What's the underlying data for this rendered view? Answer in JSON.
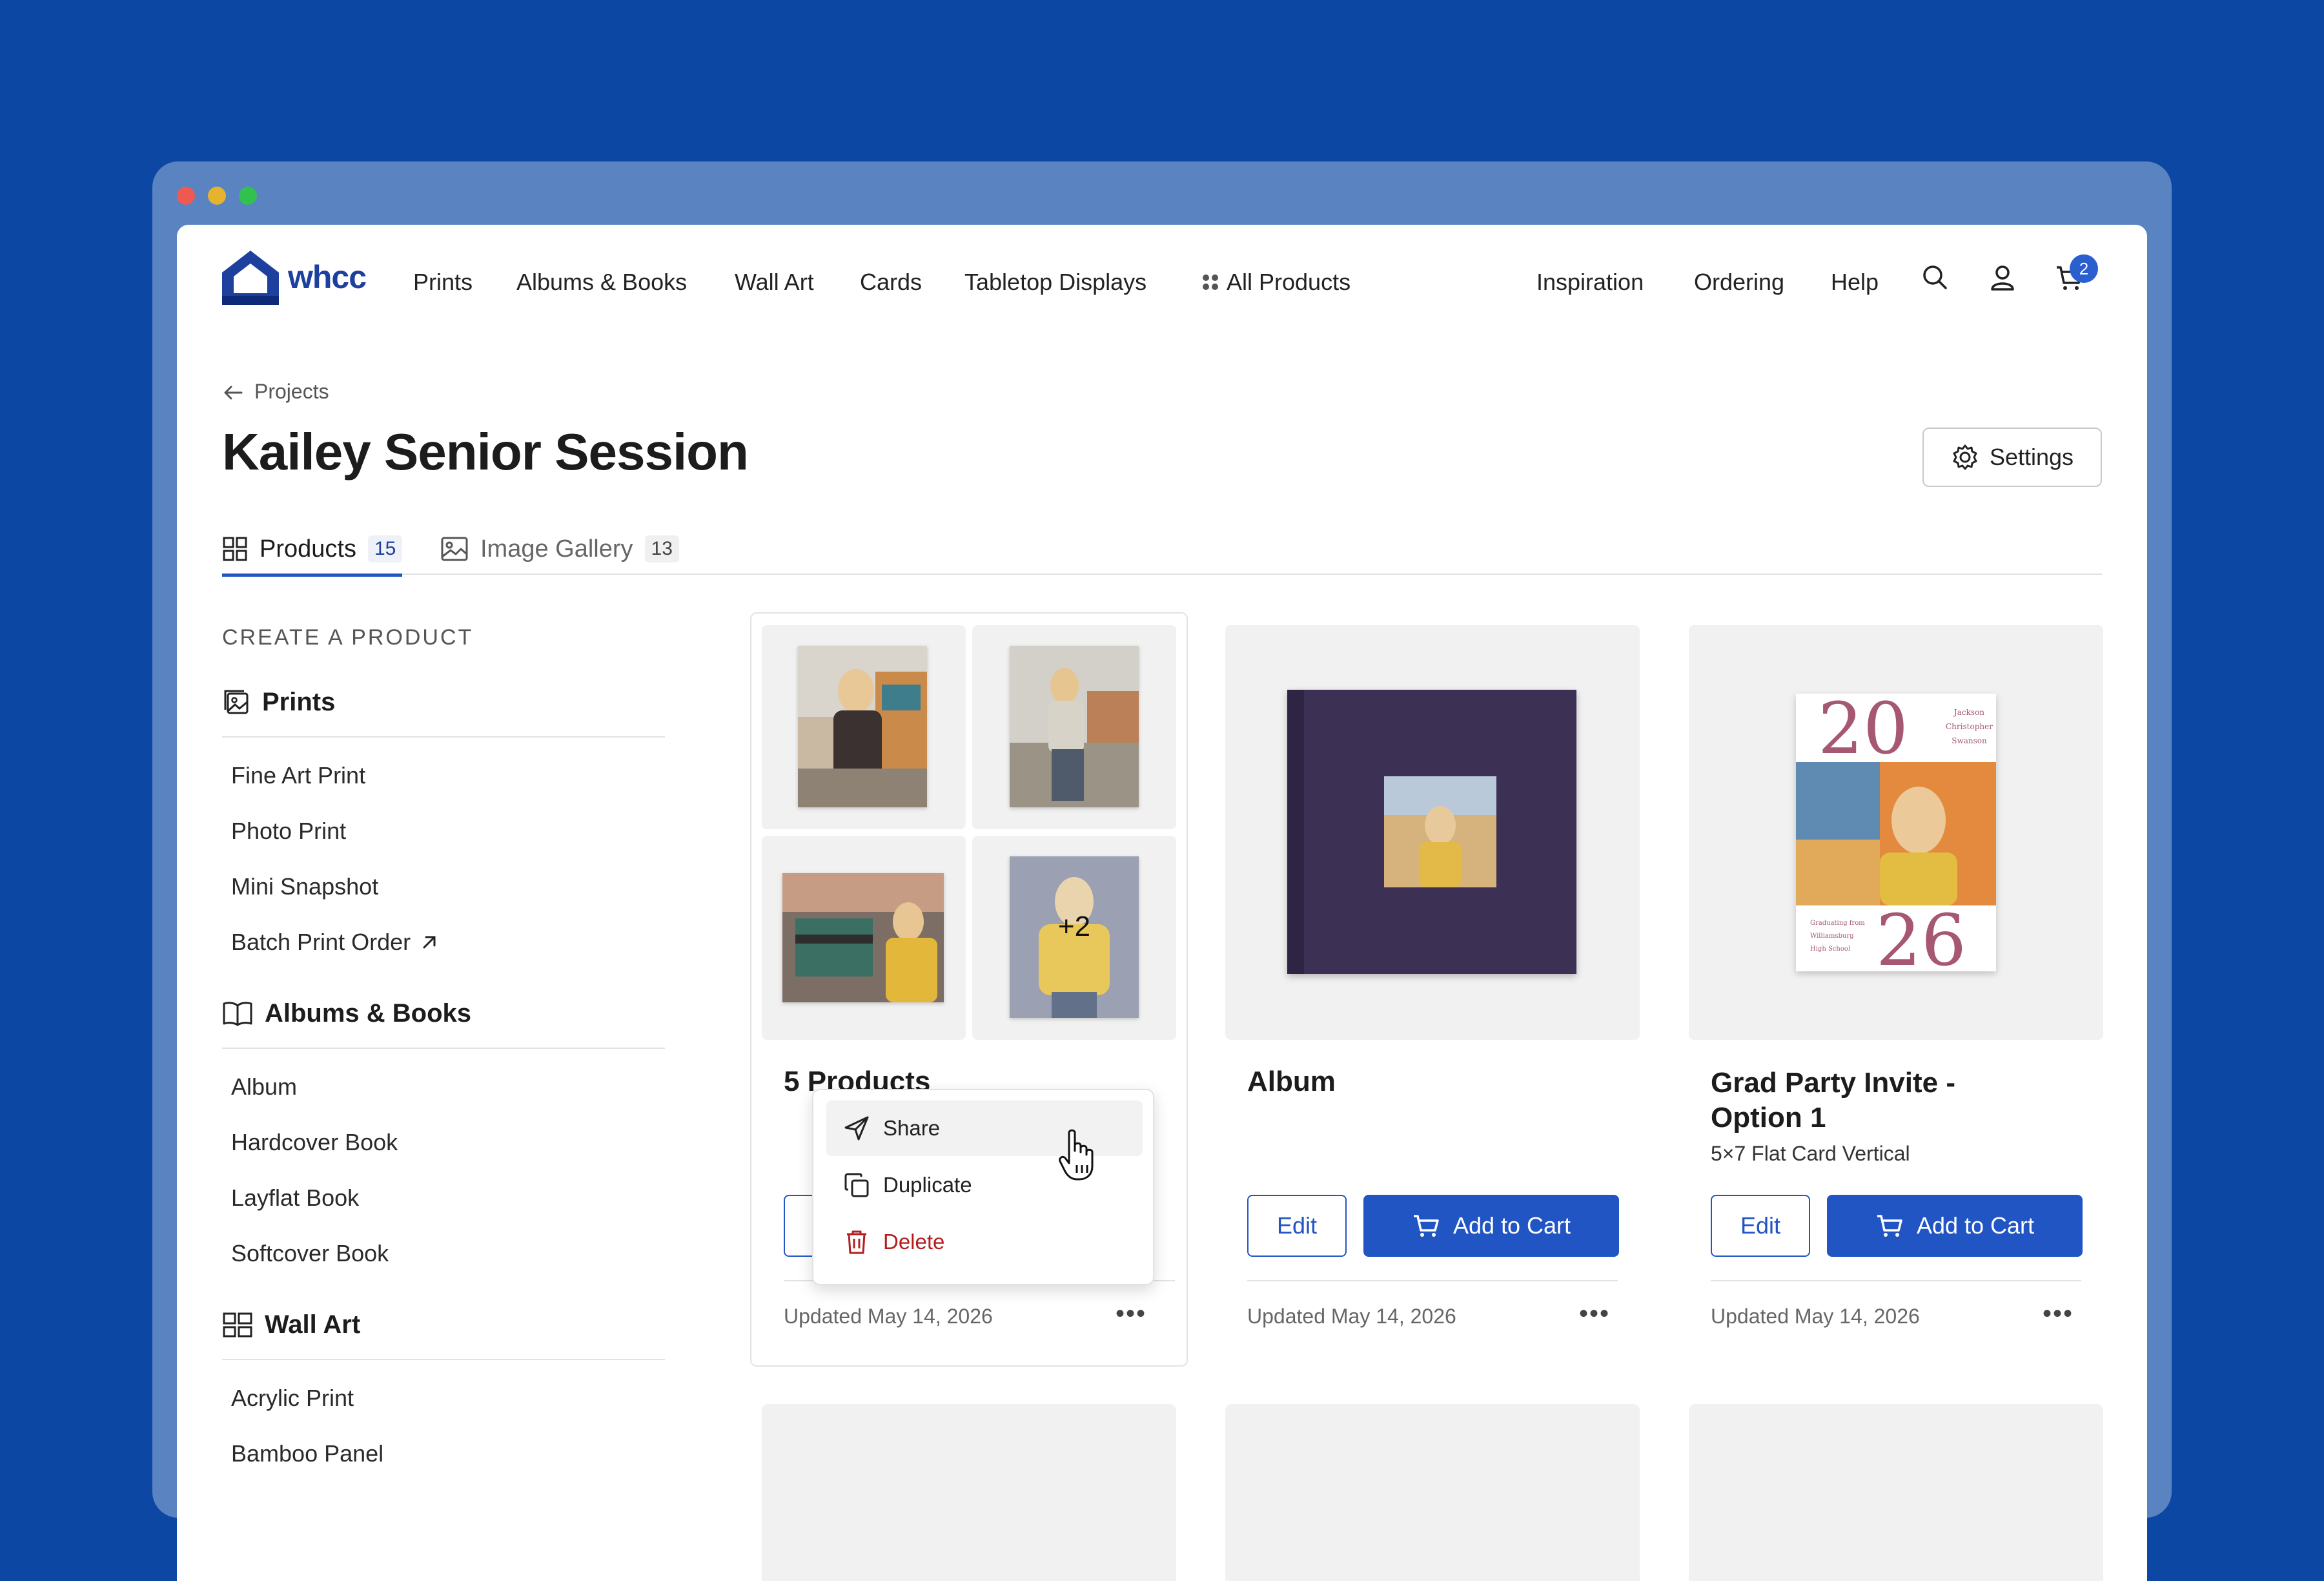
{
  "header": {
    "logo_text": "whcc",
    "nav": [
      "Prints",
      "Albums & Books",
      "Wall Art",
      "Cards",
      "Tabletop Displays",
      "All Products"
    ],
    "right_nav": [
      "Inspiration",
      "Ordering",
      "Help"
    ],
    "cart_count": "2"
  },
  "breadcrumb": "Projects",
  "page_title": "Kailey Senior Session",
  "settings_label": "Settings",
  "tabs": [
    {
      "label": "Products",
      "count": "15"
    },
    {
      "label": "Image Gallery",
      "count": "13"
    }
  ],
  "sidebar": {
    "heading": "CREATE A PRODUCT",
    "categories": [
      {
        "name": "Prints",
        "items": [
          "Fine Art Print",
          "Photo Print",
          "Mini Snapshot",
          "Batch Print Order"
        ]
      },
      {
        "name": "Albums & Books",
        "items": [
          "Album",
          "Hardcover Book",
          "Layflat Book",
          "Softcover Book"
        ]
      },
      {
        "name": "Wall Art",
        "items": [
          "Acrylic Print",
          "Bamboo Panel"
        ]
      }
    ]
  },
  "cards": [
    {
      "title": "5 Products",
      "more_count": "+2",
      "updated": "Updated May 14, 2026"
    },
    {
      "title": "Album",
      "edit": "Edit",
      "add_to_cart": "Add to Cart",
      "updated": "Updated May 14, 2026"
    },
    {
      "title": "Grad Party Invite - Option 1",
      "subtitle": "5×7 Flat Card Vertical",
      "edit": "Edit",
      "add_to_cart": "Add to Cart",
      "updated": "Updated May 14, 2026",
      "invite": {
        "top_num": "20",
        "bottom_num": "26",
        "names": [
          "Jackson",
          "Christopher",
          "Swanson"
        ],
        "footer": [
          "Graduating from",
          "Williamsburg",
          "High School"
        ]
      }
    }
  ],
  "context_menu": [
    "Share",
    "Duplicate",
    "Delete"
  ],
  "colors": {
    "brand_blue": "#2155c4",
    "background": "#0c47a4",
    "danger": "#b41e1e"
  }
}
